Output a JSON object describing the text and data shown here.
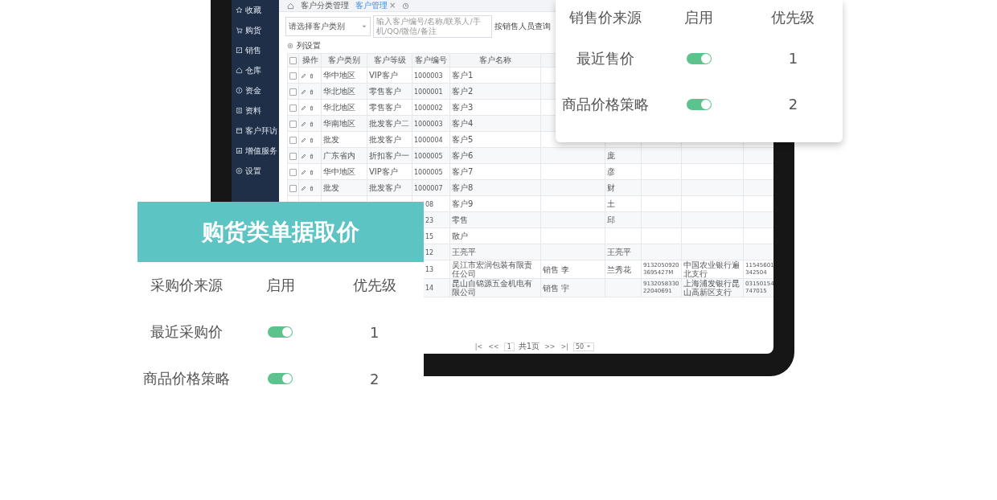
{
  "tablet": {
    "sidebar": {
      "items": [
        {
          "label": "收藏"
        },
        {
          "label": "购货"
        },
        {
          "label": "销售"
        },
        {
          "label": "仓库"
        },
        {
          "label": "资金"
        },
        {
          "label": "资料"
        },
        {
          "label": "客户拜访"
        },
        {
          "label": "增值服务"
        },
        {
          "label": "设置"
        }
      ]
    },
    "tabs": [
      {
        "label": "客户分类管理",
        "selected": false
      },
      {
        "label": "客户管理",
        "selected": true,
        "close": "×"
      }
    ],
    "filter": {
      "category_select": "请选择客户类别",
      "search_placeholder": "输入客户编号/名称/联系人/手机/QQ/微信/备注",
      "query_button": "按销售人员查询"
    },
    "column_settings": "列设置",
    "table": {
      "select_all_checked": false,
      "columns": [
        "操作",
        "客户类别",
        "客户等级",
        "客户编号",
        "客户名称"
      ],
      "rows": [
        {
          "kind": "full",
          "checked": false,
          "category": "华中地区",
          "level": "VIP客户",
          "number": "1000003",
          "name": "客户1"
        },
        {
          "kind": "full",
          "checked": false,
          "category": "华北地区",
          "level": "零售客户",
          "number": "1000001",
          "name": "客户2"
        },
        {
          "kind": "full",
          "checked": false,
          "category": "华北地区",
          "level": "零售客户",
          "number": "1000002",
          "name": "客户3"
        },
        {
          "kind": "full",
          "checked": false,
          "category": "华南地区",
          "level": "批发客户二",
          "number": "1000003",
          "name": "客户4"
        },
        {
          "kind": "full",
          "checked": false,
          "category": "批发",
          "level": "批发客户",
          "number": "1000004",
          "name": "客户5"
        },
        {
          "kind": "full",
          "checked": false,
          "category": "广东省内",
          "level": "折扣客户一",
          "number": "1000005",
          "name": "客户6",
          "column_8": "庞"
        },
        {
          "kind": "full",
          "checked": false,
          "category": "华中地区",
          "level": "VIP客户",
          "number": "1000005",
          "name": "客户7",
          "column_8": "彦"
        },
        {
          "kind": "full",
          "checked": false,
          "category": "批发",
          "level": "批发客户",
          "number": "1000007",
          "name": "客户8",
          "column_8": "财"
        },
        {
          "kind": "covered",
          "number": "08",
          "name": "客户9",
          "column_8": "土"
        },
        {
          "kind": "covered",
          "number": "23",
          "name": "零售",
          "column_8": "邱"
        },
        {
          "kind": "covered",
          "number": "15",
          "name": "散户"
        },
        {
          "kind": "covered",
          "number": "12",
          "name": "王亮平",
          "column_8": "王亮平"
        },
        {
          "kind": "covered",
          "number": "13",
          "name": "吴江市宏润包装有限责任公司",
          "column_7": "销售 李",
          "column_8": "兰秀花",
          "column_9": "91320509203695427M",
          "column_10": "中国农业银行遍北支行",
          "column_11": "11545601342504"
        },
        {
          "kind": "covered",
          "number": "14",
          "name": "昆山自锦源五金机电有限公司",
          "column_7": "销售 宇",
          "column_9": "913205833022040691",
          "column_10": "上海浦发银行昆山高新区支行",
          "column_11": "03150154747015"
        }
      ]
    },
    "pagination": {
      "first": "|<",
      "previous": "<<",
      "page": "1",
      "total": "共1页",
      "next": ">>",
      "last": ">|",
      "page_size": "50"
    }
  },
  "sales_price_card": {
    "columns": [
      "销售价来源",
      "启用",
      "优先级"
    ],
    "rows": [
      {
        "source": "最近售价",
        "enabled": true,
        "priority": "1"
      },
      {
        "source": "商品价格策略",
        "enabled": true,
        "priority": "2"
      }
    ]
  },
  "purchase_price_card": {
    "title": "购货类单据取价",
    "columns": [
      "采购价来源",
      "启用",
      "优先级"
    ],
    "rows": [
      {
        "source": "最近采购价",
        "enabled": true,
        "priority": "1"
      },
      {
        "source": "商品价格策略",
        "enabled": true,
        "priority": "2"
      }
    ]
  }
}
